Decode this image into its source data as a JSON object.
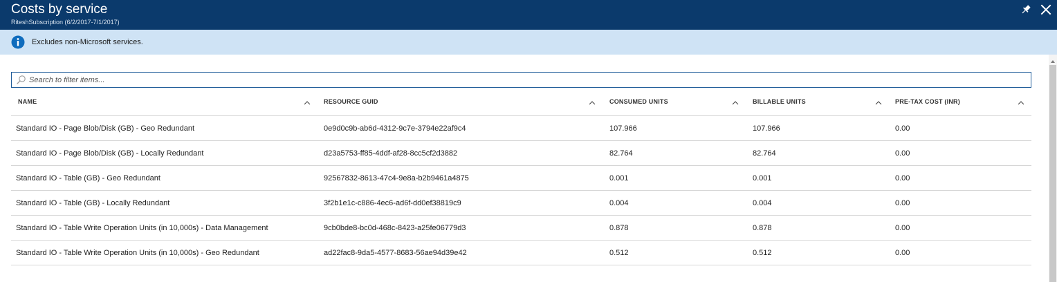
{
  "blade": {
    "title": "Costs by service",
    "subtitle": "RiteshSubscription (6/2/2017-7/1/2017)",
    "pin_icon": "pin-icon",
    "close_icon": "close-icon"
  },
  "info": {
    "icon": "info-icon",
    "text": "Excludes non-Microsoft services."
  },
  "search": {
    "icon": "search-icon",
    "placeholder": "Search to filter items...",
    "value": ""
  },
  "table": {
    "sort_icon": "chevron-up-icon",
    "columns": [
      "NAME",
      "RESOURCE GUID",
      "CONSUMED UNITS",
      "BILLABLE UNITS",
      "PRE-TAX COST (INR)"
    ],
    "rows": [
      [
        "Standard IO - Page Blob/Disk (GB) - Geo Redundant",
        "0e9d0c9b-ab6d-4312-9c7e-3794e22af9c4",
        "107.966",
        "107.966",
        "0.00"
      ],
      [
        "Standard IO - Page Blob/Disk (GB) - Locally Redundant",
        "d23a5753-ff85-4ddf-af28-8cc5cf2d3882",
        "82.764",
        "82.764",
        "0.00"
      ],
      [
        "Standard IO - Table (GB) - Geo Redundant",
        "92567832-8613-47c4-9e8a-b2b9461a4875",
        "0.001",
        "0.001",
        "0.00"
      ],
      [
        "Standard IO - Table (GB) - Locally Redundant",
        "3f2b1e1c-c886-4ec6-ad6f-dd0ef38819c9",
        "0.004",
        "0.004",
        "0.00"
      ],
      [
        "Standard IO - Table Write Operation Units (in 10,000s) - Data Management",
        "9cb0bde8-bc0d-468c-8423-a25fe06779d3",
        "0.878",
        "0.878",
        "0.00"
      ],
      [
        "Standard IO - Table Write Operation Units (in 10,000s) - Geo Redundant",
        "ad22fac8-9da5-4577-8683-56ae94d39e42",
        "0.512",
        "0.512",
        "0.00"
      ]
    ]
  },
  "colors": {
    "header_bg": "#0b3a6c",
    "info_bg": "#cfe3f5",
    "info_icon": "#0f6cbd",
    "search_border": "#1f5c99"
  }
}
